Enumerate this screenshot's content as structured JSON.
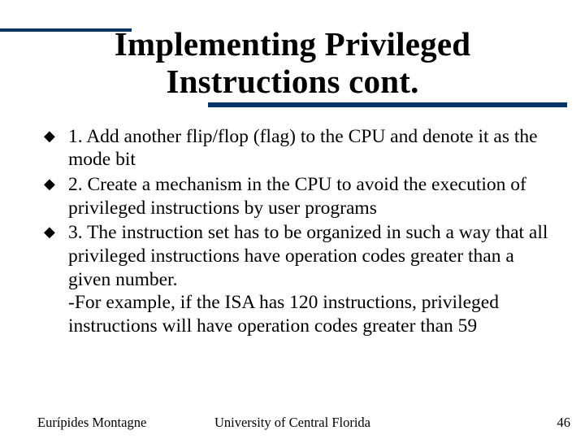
{
  "title_line1": "Implementing Privileged",
  "title_line2": "Instructions cont.",
  "bullets": [
    {
      "text": "1.  Add another flip/flop (flag) to the CPU and denote it as the mode bit"
    },
    {
      "text": "2.  Create a mechanism in the CPU to avoid the execution of privileged instructions by user programs"
    },
    {
      "text": "3.  The instruction set has to be organized in such a way that all privileged instructions have operation codes greater than a given number.",
      "sub": "-For example, if the ISA has 120 instructions, privileged instructions will have operation codes greater than 59"
    }
  ],
  "footer": {
    "left": "Eurípides Montagne",
    "center": "University of Central Florida",
    "right": "46"
  }
}
